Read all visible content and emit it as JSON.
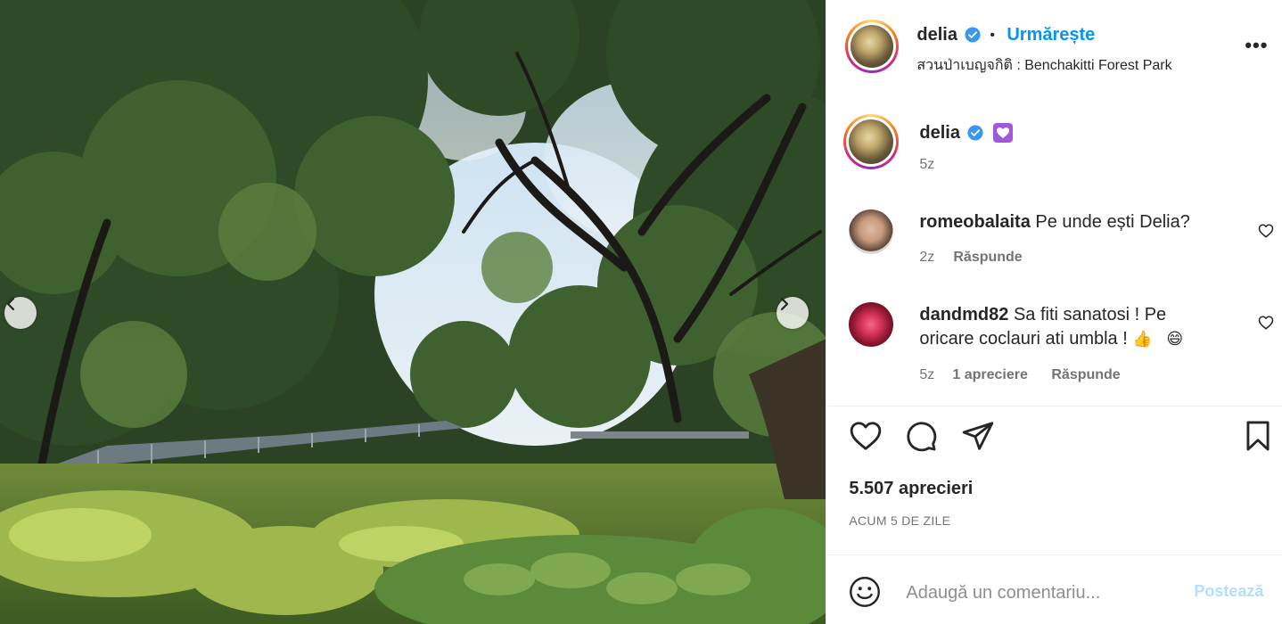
{
  "post": {
    "author": "delia",
    "follow_label": "Urmărește",
    "location": "สวนป่าเบญจกิติ : Benchakitti Forest Park",
    "more_label": "•••",
    "dot": "•"
  },
  "caption": {
    "author": "delia",
    "time": "5z"
  },
  "comments": [
    {
      "username": "romeobalaita",
      "text": "Pe unde ești Delia?",
      "time": "2z",
      "reply_label": "Răspunde"
    },
    {
      "username": "dandmd82",
      "text_line1": "Sa fiti sanatosi ! Pe",
      "text_line2": "oricare coclauri ati umbla ! ",
      "emoji1": "👍",
      "emoji2": "😄",
      "time": "5z",
      "likes_label": "1 apreciere",
      "reply_label": "Răspunde"
    }
  ],
  "engagement": {
    "likes": "5.507 aprecieri",
    "date": "ACUM 5 DE ZILE"
  },
  "composer": {
    "placeholder": "Adaugă un comentariu...",
    "post_label": "Postează"
  },
  "colors": {
    "accent": "#0095f6",
    "verified": "#3897f0",
    "purple_heart": "#a259d9"
  },
  "icons": {
    "prev": "chevron-left-icon",
    "next": "chevron-right-icon",
    "like": "heart-icon",
    "comment": "comment-icon",
    "share": "paper-plane-icon",
    "save": "bookmark-icon",
    "emoji": "smiley-icon"
  }
}
